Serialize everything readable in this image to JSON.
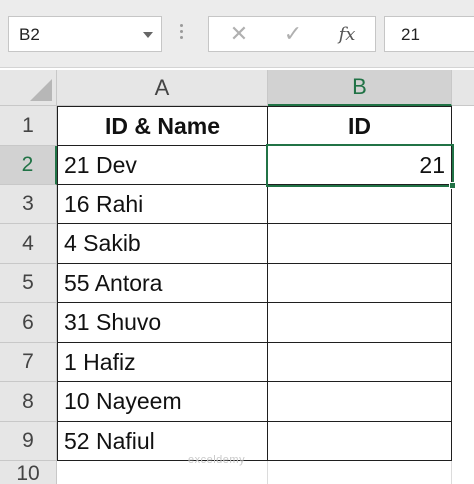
{
  "formula_bar": {
    "name_box": "B2",
    "cancel_icon": "✕",
    "enter_icon": "✓",
    "fx_label": "fx",
    "content": "21"
  },
  "columns": [
    {
      "label": "A"
    },
    {
      "label": "B"
    }
  ],
  "rows": [
    {
      "num": "1",
      "a": "ID & Name",
      "b": "ID"
    },
    {
      "num": "2",
      "a": "21 Dev",
      "b": "21"
    },
    {
      "num": "3",
      "a": "16 Rahi",
      "b": ""
    },
    {
      "num": "4",
      "a": "4 Sakib",
      "b": ""
    },
    {
      "num": "5",
      "a": "55 Antora",
      "b": ""
    },
    {
      "num": "6",
      "a": "31 Shuvo",
      "b": ""
    },
    {
      "num": "7",
      "a": "1 Hafiz",
      "b": ""
    },
    {
      "num": "8",
      "a": "10 Nayeem",
      "b": ""
    },
    {
      "num": "9",
      "a": "52 Nafiul",
      "b": ""
    },
    {
      "num": "10",
      "a": "",
      "b": ""
    }
  ],
  "selection": {
    "cell": "B2"
  },
  "watermark": "exceldemy",
  "colors": {
    "accent": "#217346",
    "header_bg": "#e6e6e6"
  }
}
